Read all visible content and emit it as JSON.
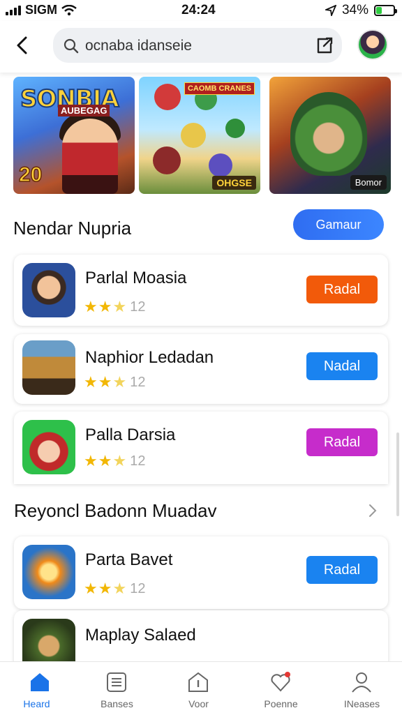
{
  "status_bar": {
    "carrier": "SIGM",
    "time": "24:24",
    "battery_percent": "34%",
    "battery_level": 0.34
  },
  "search": {
    "query": "ocnaba idanseie"
  },
  "banners": [
    {
      "title": "SONBIA",
      "subtitle": "AUBEGAG",
      "number": "20"
    },
    {
      "badge": "CAOMB CRANES",
      "tag": "OHGSE"
    },
    {
      "tag": "Bomor"
    }
  ],
  "section1": {
    "title": "Nendar Nupria",
    "button_label": "Gamaur"
  },
  "section2": {
    "title": "Reyoncl  Badonn Muadav"
  },
  "apps": [
    {
      "name": "Parlal Moasia",
      "rating_count": "12",
      "action": "Radal",
      "color": "#f25a0a"
    },
    {
      "name": "Naphior Ledadan",
      "rating_count": "12",
      "action": "Nadal",
      "color": "#1a83f0"
    },
    {
      "name": "Palla Darsia",
      "rating_count": "12",
      "action": "Radal",
      "color": "#c62ccb"
    },
    {
      "name": "Parta Bavet",
      "rating_count": "12",
      "action": "Radal",
      "color": "#1a83f0"
    },
    {
      "name": "Maplay Salaed"
    }
  ],
  "tabs": [
    {
      "label": "Heard",
      "icon": "home-icon",
      "active": true
    },
    {
      "label": "Banses",
      "icon": "list-icon"
    },
    {
      "label": "Voor",
      "icon": "info-icon"
    },
    {
      "label": "Poenne",
      "icon": "heart-icon"
    },
    {
      "label": "INeases",
      "icon": "profile-icon"
    }
  ]
}
